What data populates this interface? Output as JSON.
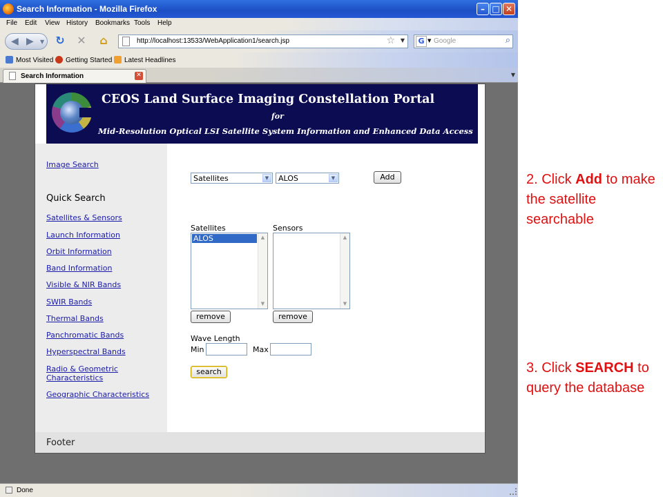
{
  "browser": {
    "title": "Search Information - Mozilla Firefox",
    "menu": [
      "File",
      "Edit",
      "View",
      "History",
      "Bookmarks",
      "Tools",
      "Help"
    ],
    "url": "http://localhost:13533/WebApplication1/search.jsp",
    "search_placeholder": "Google",
    "bookmarks": [
      "Most Visited",
      "Getting Started",
      "Latest Headlines"
    ],
    "tab_title": "Search Information",
    "status": "Done",
    "window_buttons": [
      "minimize",
      "maximize",
      "close"
    ]
  },
  "banner": {
    "title": "CEOS Land Surface Imaging Constellation Portal",
    "for": "for",
    "subtitle": "Mid-Resolution Optical LSI Satellite System Information and Enhanced Data Access"
  },
  "sidebar": {
    "image_search": "Image Search",
    "quick_search_heading": "Quick Search",
    "links": [
      "Satellites & Sensors",
      "Launch Information",
      "Orbit Information",
      "Band Information",
      "Visible & NIR Bands",
      "SWIR Bands",
      "Thermal Bands",
      "Panchromatic Bands",
      "Hyperspectral Bands",
      "Radio & Geometric",
      "Characteristics",
      "Geographic Characteristics"
    ]
  },
  "main": {
    "category_select": "Satellites",
    "value_select": "ALOS",
    "add_button": "Add",
    "satellites_label": "Satellites",
    "sensors_label": "Sensors",
    "satellites_list": [
      "ALOS"
    ],
    "remove_button": "remove",
    "wave_length_label": "Wave Length",
    "min_label": "Min",
    "max_label": "Max",
    "min_value": "",
    "max_value": "",
    "search_button": "search"
  },
  "footer": "Footer",
  "annotations": {
    "step2_prefix": "2. Click ",
    "step2_bold": "Add",
    "step2_suffix": " to make the satellite searchable",
    "step3_prefix": "3. Click ",
    "step3_bold": "SEARCH",
    "step3_suffix": " to query the database"
  }
}
